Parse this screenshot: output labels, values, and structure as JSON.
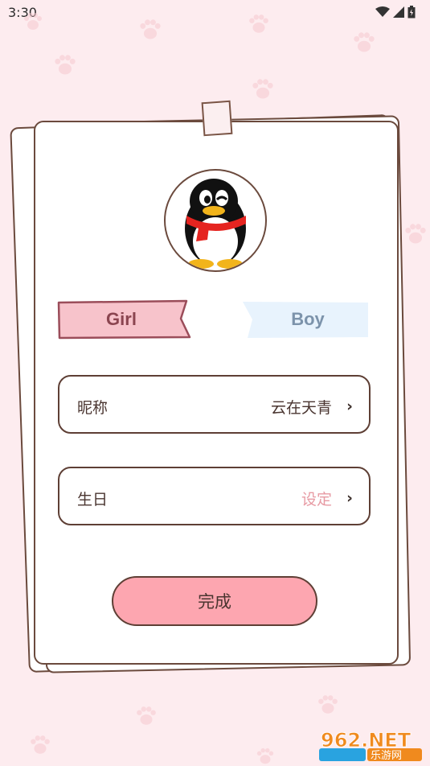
{
  "status_bar": {
    "time": "3:30"
  },
  "gender": {
    "girl_label": "Girl",
    "boy_label": "Boy"
  },
  "fields": {
    "nickname": {
      "label": "昵称",
      "value": "云在天青",
      "chevron": "›"
    },
    "birthday": {
      "label": "生日",
      "value": "设定",
      "chevron": "›"
    }
  },
  "actions": {
    "done_label": "完成"
  },
  "colors": {
    "background": "#fdecef",
    "border": "#6b4a3d",
    "girl_tag": "#f7c3cb",
    "boy_tag": "#e8f3fd",
    "done_button": "#fda6b0",
    "placeholder_value": "#e79aa3"
  },
  "icons": {
    "wifi": "wifi-icon",
    "signal": "signal-icon",
    "battery": "battery-icon",
    "avatar": "qq-penguin-avatar",
    "chevron": "chevron-right-icon",
    "decor": "paw-print-icon"
  },
  "watermark": {
    "brand": "962.NET",
    "site": "乐游网"
  }
}
